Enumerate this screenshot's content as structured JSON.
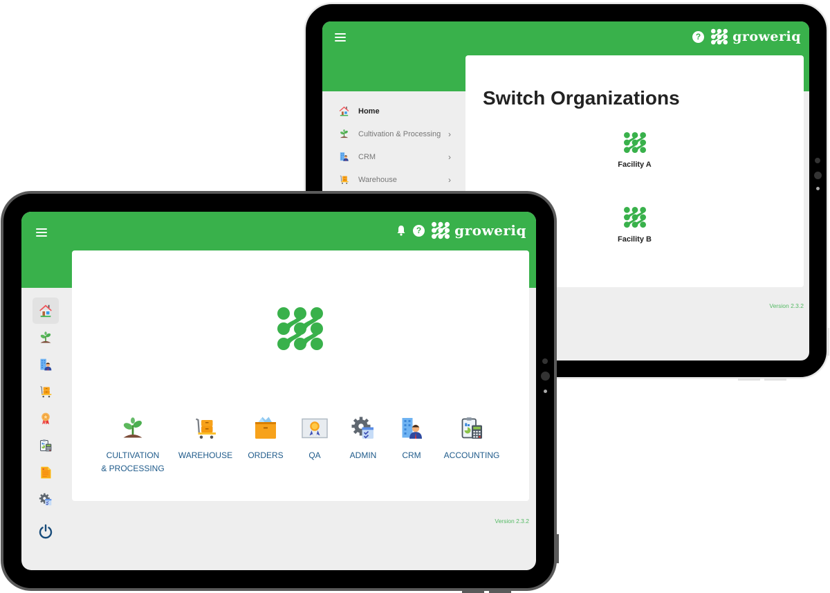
{
  "brand": {
    "name": "groweriq",
    "primary_color": "#39b14b",
    "module_text_color": "#1e5a8a",
    "background_color": "#eeeeee"
  },
  "back_tablet": {
    "header": {
      "menu_icon": "hamburger-icon",
      "help_icon": "?",
      "logo_text": "groweriq"
    },
    "sidebar": {
      "items": [
        {
          "label": "Home",
          "icon": "house-icon",
          "active": true,
          "has_submenu": false
        },
        {
          "label": "Cultivation & Processing",
          "icon": "plant-icon",
          "active": false,
          "has_submenu": true
        },
        {
          "label": "CRM",
          "icon": "crm-building-person-icon",
          "active": false,
          "has_submenu": true
        },
        {
          "label": "Warehouse",
          "icon": "warehouse-cart-icon",
          "active": false,
          "has_submenu": true
        }
      ],
      "chevron": "›"
    },
    "page_title": "Switch Organizations",
    "organizations": [
      {
        "name": "Facility A",
        "icon": "groweriq-logo-icon"
      },
      {
        "name": "Facility B",
        "icon": "groweriq-logo-icon"
      }
    ],
    "version": "Version 2.3.2"
  },
  "front_tablet": {
    "header": {
      "menu_icon": "hamburger-icon",
      "bell_icon": "bell-icon",
      "help_icon": "?",
      "logo_text": "groweriq"
    },
    "rail": [
      {
        "name": "home",
        "icon": "house-icon",
        "active": true
      },
      {
        "name": "cultivation",
        "icon": "plant-icon",
        "active": false
      },
      {
        "name": "crm",
        "icon": "crm-building-person-icon",
        "active": false
      },
      {
        "name": "warehouse",
        "icon": "warehouse-cart-icon",
        "active": false
      },
      {
        "name": "qa",
        "icon": "award-ribbon-icon",
        "active": false
      },
      {
        "name": "accounting",
        "icon": "clipboard-calculator-icon",
        "active": false
      },
      {
        "name": "orders",
        "icon": "document-icon",
        "active": false
      },
      {
        "name": "admin",
        "icon": "gear-checklist-icon",
        "active": false
      },
      {
        "name": "logout",
        "icon": "power-icon",
        "active": false
      }
    ],
    "modules": [
      {
        "label": "CULTIVATION\n& PROCESSING",
        "icon": "plant-icon"
      },
      {
        "label": "WAREHOUSE",
        "icon": "warehouse-cart-icon"
      },
      {
        "label": "ORDERS",
        "icon": "orders-box-icon"
      },
      {
        "label": "QA",
        "icon": "qa-certificate-icon"
      },
      {
        "label": "ADMIN",
        "icon": "gear-checklist-icon"
      },
      {
        "label": "CRM",
        "icon": "crm-building-person-icon"
      },
      {
        "label": "ACCOUNTING",
        "icon": "clipboard-calculator-icon"
      }
    ],
    "version": "Version 2.3.2"
  }
}
